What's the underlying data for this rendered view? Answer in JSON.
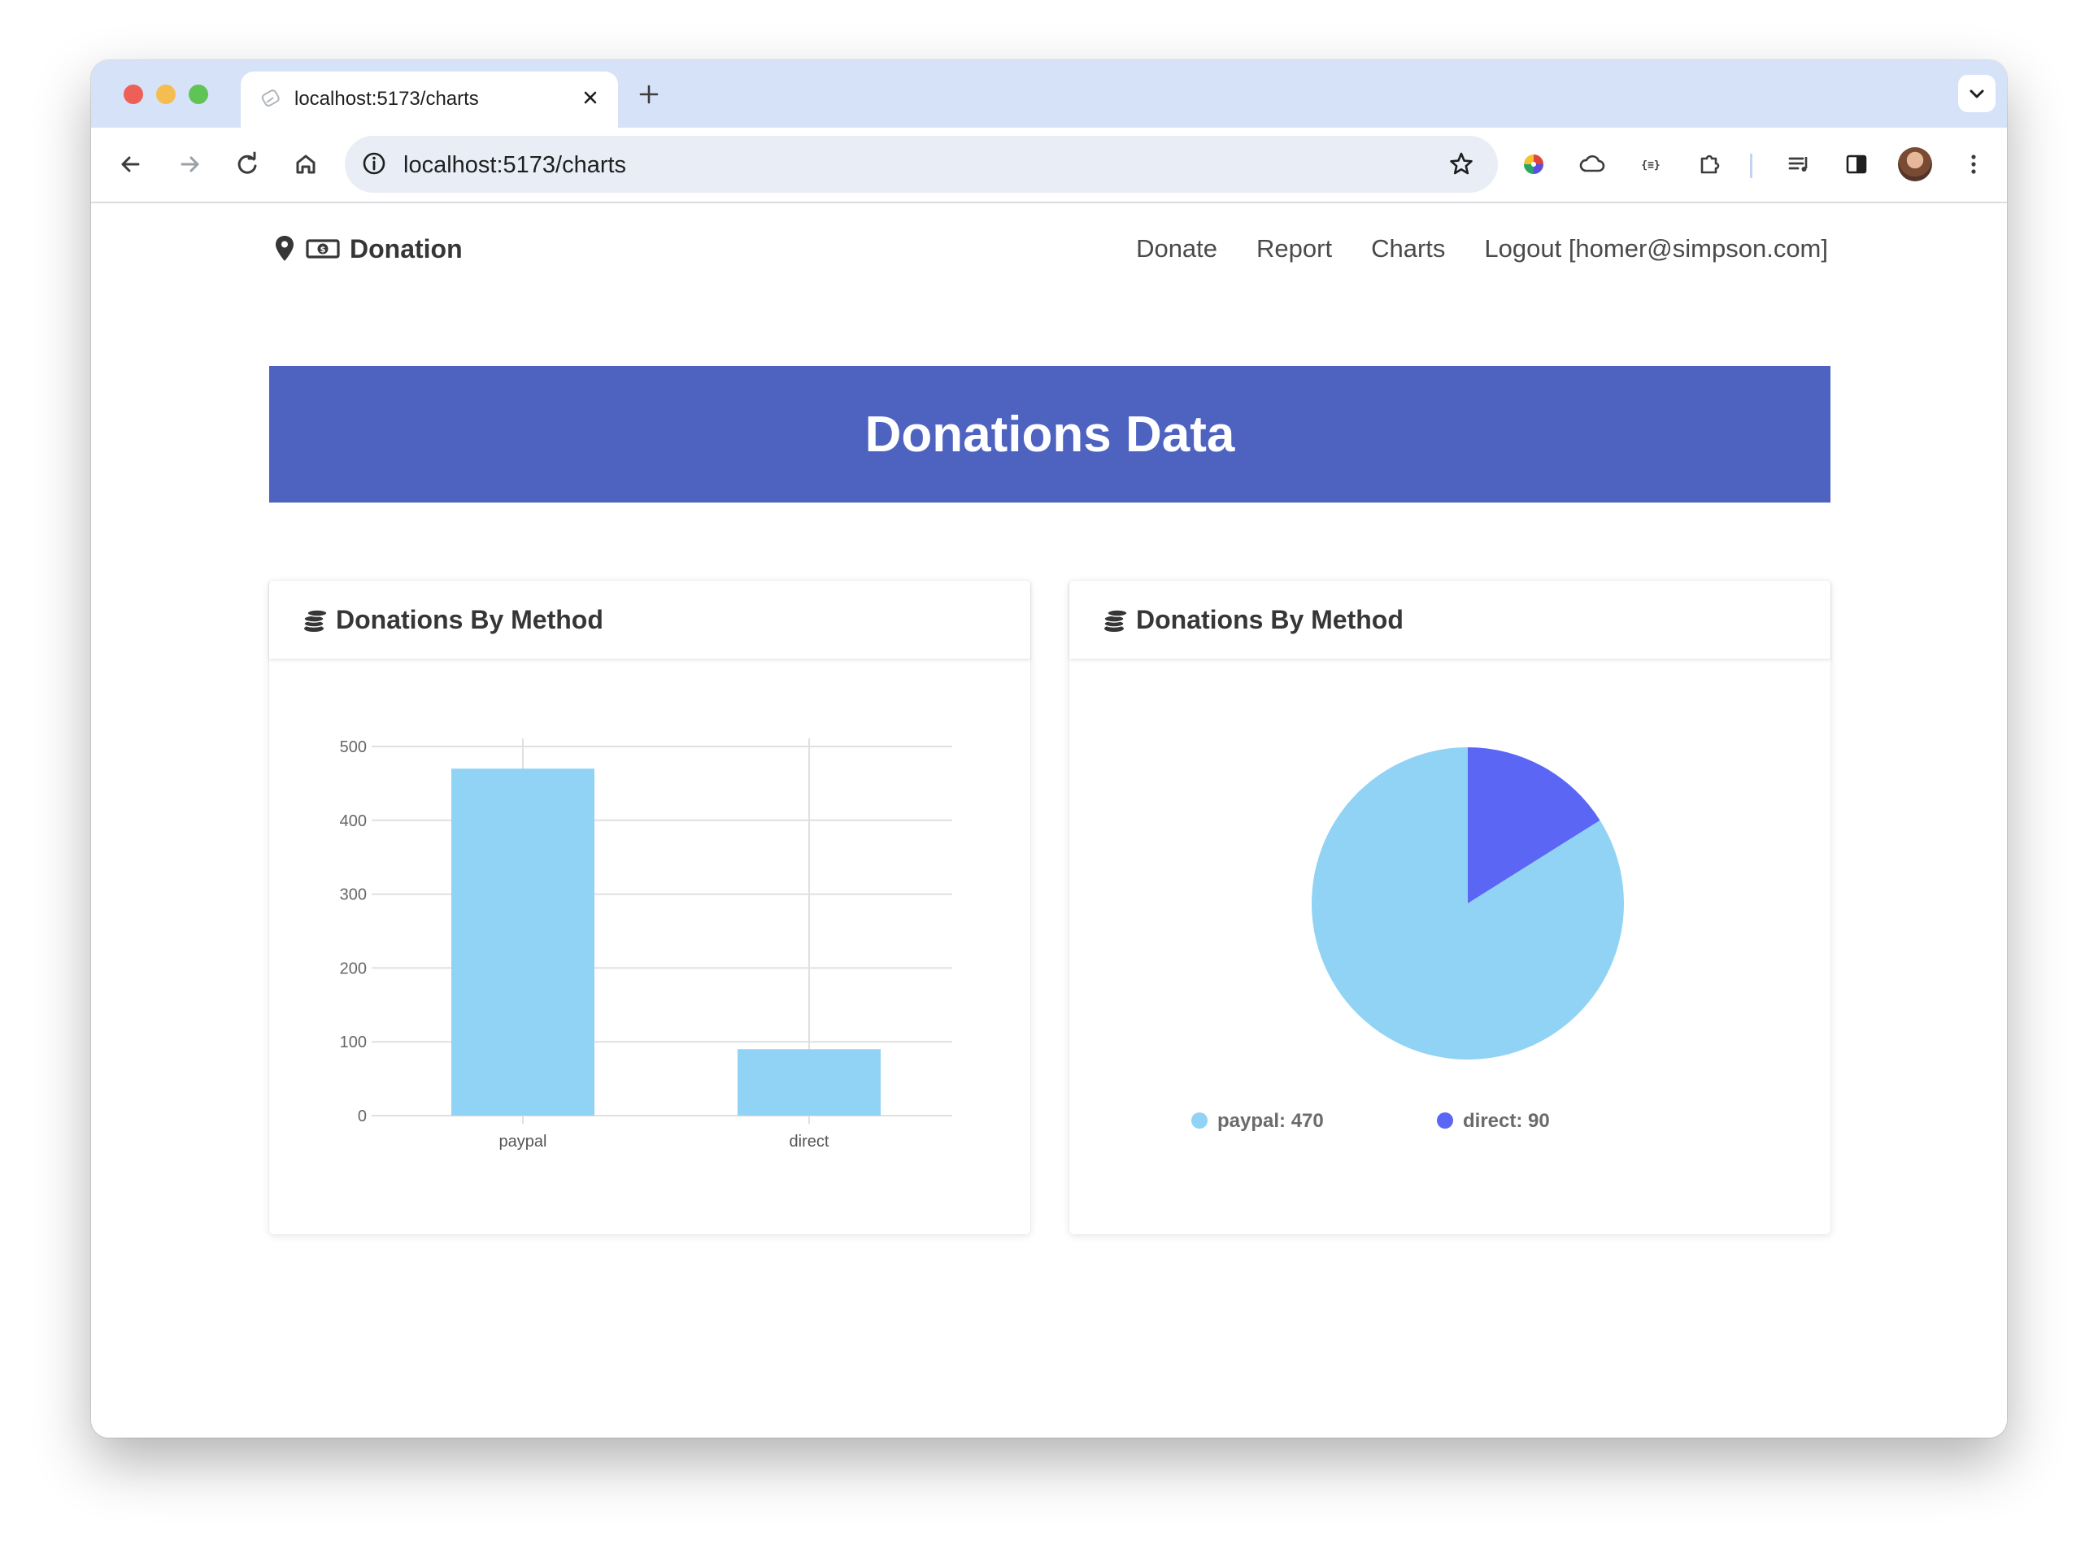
{
  "browser": {
    "tab_title": "localhost:5173/charts",
    "url": "localhost:5173/charts"
  },
  "navbar": {
    "brand": "Donation",
    "links": [
      "Donate",
      "Report",
      "Charts",
      "Logout [homer@simpson.com]"
    ]
  },
  "hero": {
    "title": "Donations Data"
  },
  "cards": [
    {
      "title": "Donations By Method"
    },
    {
      "title": "Donations By Method"
    }
  ],
  "colors": {
    "hero": "#4e62c0",
    "paypal": "#91d3f5",
    "direct": "#5c66f5",
    "tabstrip": "#d6e2f8"
  },
  "chart_data": [
    {
      "type": "bar",
      "categories": [
        "paypal",
        "direct"
      ],
      "values": [
        470,
        90
      ],
      "ylim": [
        0,
        500
      ],
      "yticks": [
        0,
        100,
        200,
        300,
        400,
        500
      ],
      "grid": true,
      "color": "#91d3f5"
    },
    {
      "type": "pie",
      "labels": [
        "paypal",
        "direct"
      ],
      "values": [
        470,
        90
      ],
      "colors": [
        "#91d3f5",
        "#5c66f5"
      ],
      "legend_labels": [
        "paypal: 470",
        "direct: 90"
      ],
      "legend": "bottom"
    }
  ]
}
